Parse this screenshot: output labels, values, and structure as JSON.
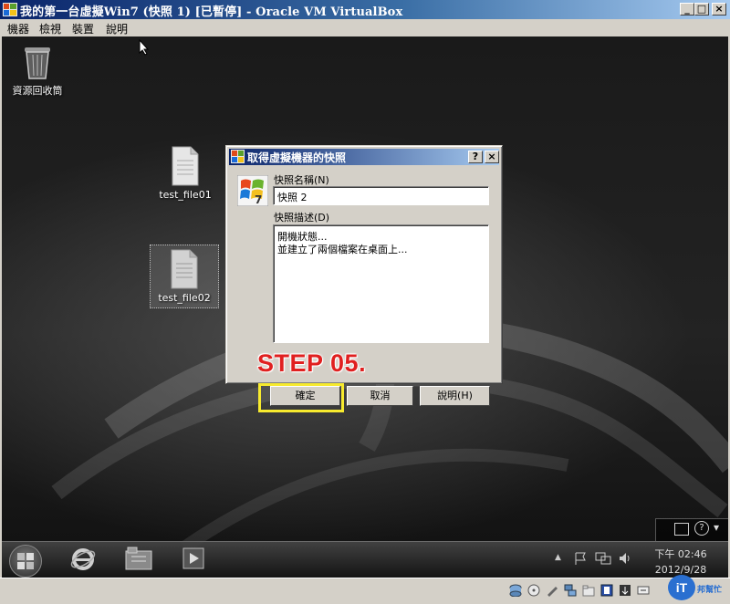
{
  "window": {
    "title": "我的第一台虛擬Win7 (快照 1) [已暫停] - Oracle VM VirtualBox",
    "minimize_glyph": "_",
    "maximize_glyph": "□",
    "close_glyph": "×",
    "icon": "virtualbox-icon"
  },
  "menu": {
    "items": [
      "機器",
      "檢視",
      "裝置",
      "說明"
    ]
  },
  "desktop": {
    "icons": [
      {
        "label": "資源回收筒",
        "icon": "recycle-bin-icon"
      },
      {
        "label": "test_file01",
        "icon": "file-icon"
      },
      {
        "label": "test_file02",
        "icon": "file-icon"
      }
    ]
  },
  "dialog": {
    "title": "取得虛擬機器的快照",
    "help_glyph": "?",
    "close_glyph": "×",
    "name_label": "快照名稱(N)",
    "name_value": "快照 2",
    "desc_label": "快照描述(D)",
    "desc_line1": "開機狀態...",
    "desc_line2": "並建立了兩個檔案在桌面上...",
    "ok": "確定",
    "cancel": "取消",
    "help": "說明(H)"
  },
  "annotation": {
    "step": "STEP 05.",
    "color": "#e02020",
    "highlight_color": "#f7ea2e"
  },
  "taskbar": {
    "clock_time": "下午 02:46",
    "clock_date": "2012/9/28",
    "show_hidden_glyph": "▲",
    "help_glyph": "?"
  },
  "status_icons": [
    "hard-disk-icon",
    "optical-drive-icon",
    "usb-icon",
    "network-icon",
    "shared-folder-icon",
    "display-icon",
    "capture-icon",
    "host-key-icon"
  ],
  "watermark": {
    "text": "iT",
    "sub": "邦幫忙"
  },
  "colors": {
    "titlebar_start": "#0a246a",
    "titlebar_end": "#a6caf0",
    "window_bg": "#d4d0c8"
  }
}
